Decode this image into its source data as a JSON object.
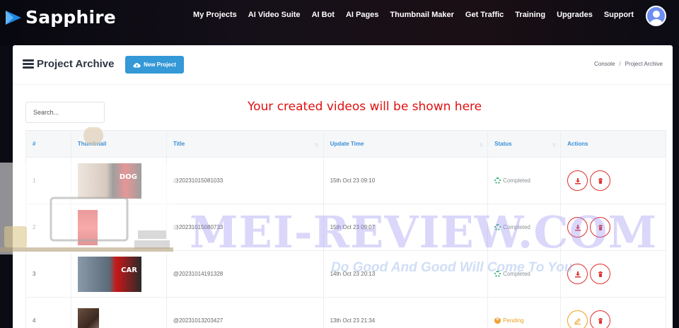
{
  "brand": {
    "name": "Sapphire"
  },
  "nav": {
    "items": [
      "My Projects",
      "AI Video Suite",
      "AI Bot",
      "AI Pages",
      "Thumbnail Maker",
      "Get Traffic",
      "Training",
      "Upgrades",
      "Support"
    ]
  },
  "header": {
    "title": "Project Archive",
    "new_project_label": "New Project",
    "breadcrumb": {
      "home": "Console",
      "separator": "/",
      "current": "Project Archive"
    }
  },
  "search": {
    "placeholder": "Search..."
  },
  "notice": "Your created videos will be shown here",
  "table": {
    "columns": [
      "#",
      "Thumbnail",
      "Title",
      "Update Time",
      "Status",
      "Actions"
    ],
    "rows": [
      {
        "num": "1",
        "thumb_text": "DOG",
        "title": "@20231015081033",
        "time": "15th Oct 23 09:10",
        "status": "Completed"
      },
      {
        "num": "2",
        "thumb_text": "",
        "title": "@20231015080733",
        "time": "15th Oct 23 09:07",
        "status": "Completed"
      },
      {
        "num": "3",
        "thumb_text": "CAR",
        "title": "@20231014191328",
        "time": "14th Oct 23 20:13",
        "status": "Completed"
      },
      {
        "num": "4",
        "thumb_text": "",
        "title": "@20231013203427",
        "time": "13th Oct 23 21:34",
        "status": "Pending"
      }
    ]
  },
  "watermark": {
    "main": "MEI-REVIEW.COM",
    "sub": "Do Good And Good Will Come To You"
  },
  "colors": {
    "accent": "#3499d6",
    "danger": "#e03030",
    "pending": "#f0a020",
    "completed": "#3cb371",
    "notice": "#e01010"
  }
}
